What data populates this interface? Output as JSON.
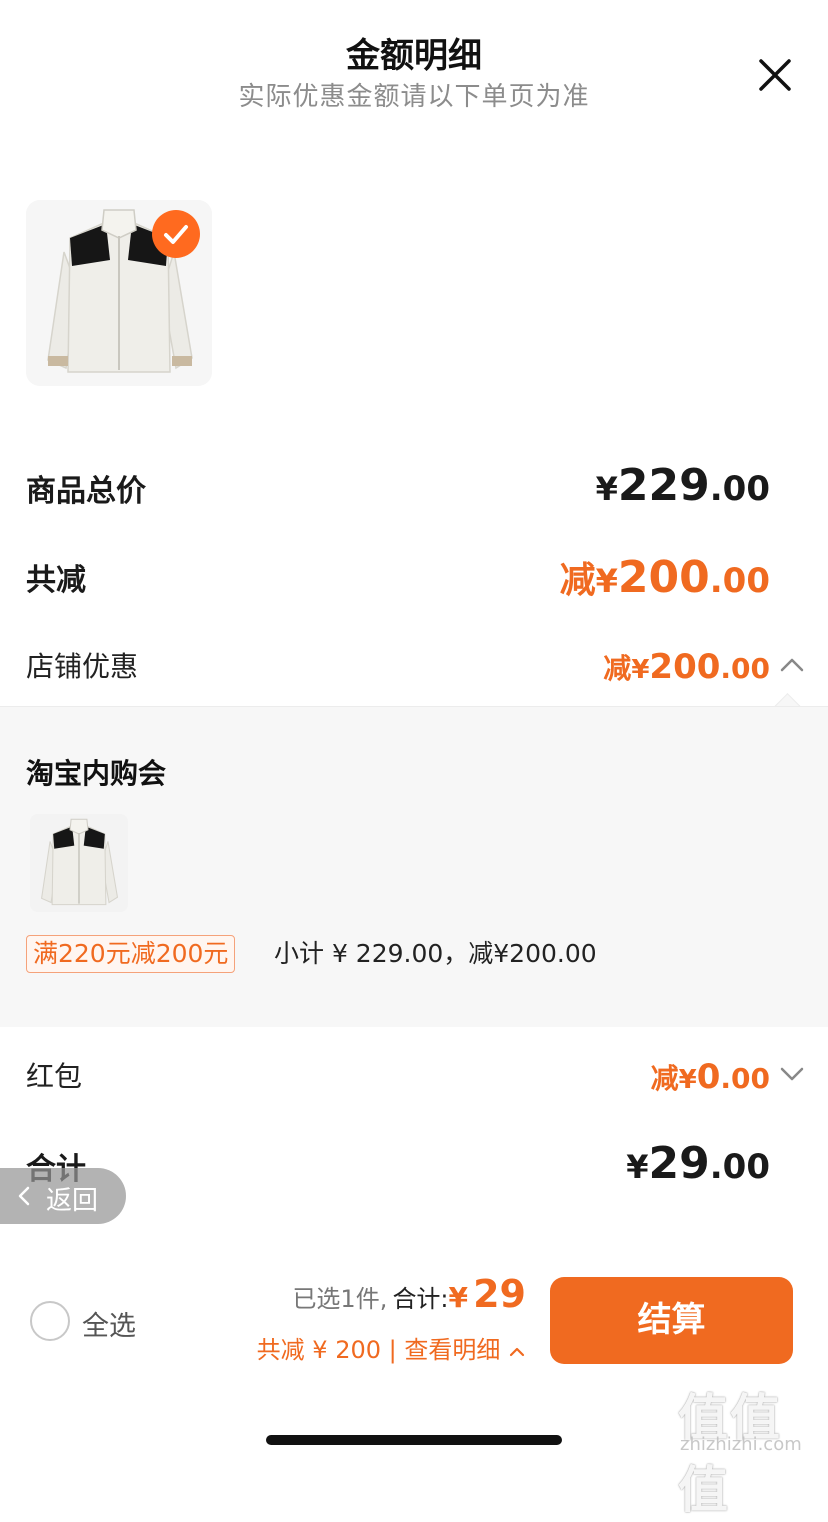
{
  "header": {
    "title": "金额明细",
    "subtitle": "实际优惠金额请以下单页为准"
  },
  "icons": {
    "close": "close-icon",
    "check": "checkmark-icon",
    "collapse": "chevron-up-icon",
    "expand": "chevron-down-icon",
    "back": "chevron-left-icon",
    "product": "white-fleece-jacket-image"
  },
  "rows": {
    "total_price": {
      "label": "商品总价",
      "yen": "¥",
      "int": "229",
      "dec": ".00"
    },
    "total_discount": {
      "label": "共减",
      "prefix": "减",
      "yen": "¥",
      "int": "200",
      "dec": ".00"
    },
    "store_discount": {
      "label": "店铺优惠",
      "prefix": "减",
      "yen": "¥",
      "int": "200",
      "dec": ".00"
    },
    "red_packet": {
      "label": "红包",
      "prefix": "减",
      "yen": "¥",
      "int": "0",
      "dec": ".00"
    },
    "grand_total": {
      "label": "合计",
      "yen": "¥",
      "int": "29",
      "dec": ".00"
    }
  },
  "promo_panel": {
    "title": "淘宝内购会",
    "tag": "满220元减200元",
    "subtotal_text": "小计 ¥ 229.00，减¥200.00"
  },
  "back_button": {
    "label": "返回"
  },
  "footer": {
    "select_all": "全选",
    "selected_count": "已选1件,",
    "total_label": "合计:",
    "total_yen": "¥",
    "total_value": "29",
    "discount_line": "共减 ¥ 200 | 查看明细",
    "checkout_label": "结算"
  },
  "watermark": {
    "logo": "值值值",
    "site": "zhizhizhi.com"
  },
  "colors": {
    "accent": "#f06a20",
    "background": "#ffffff",
    "panel": "#f7f7f7",
    "subtle_text": "#8c8c8c"
  }
}
